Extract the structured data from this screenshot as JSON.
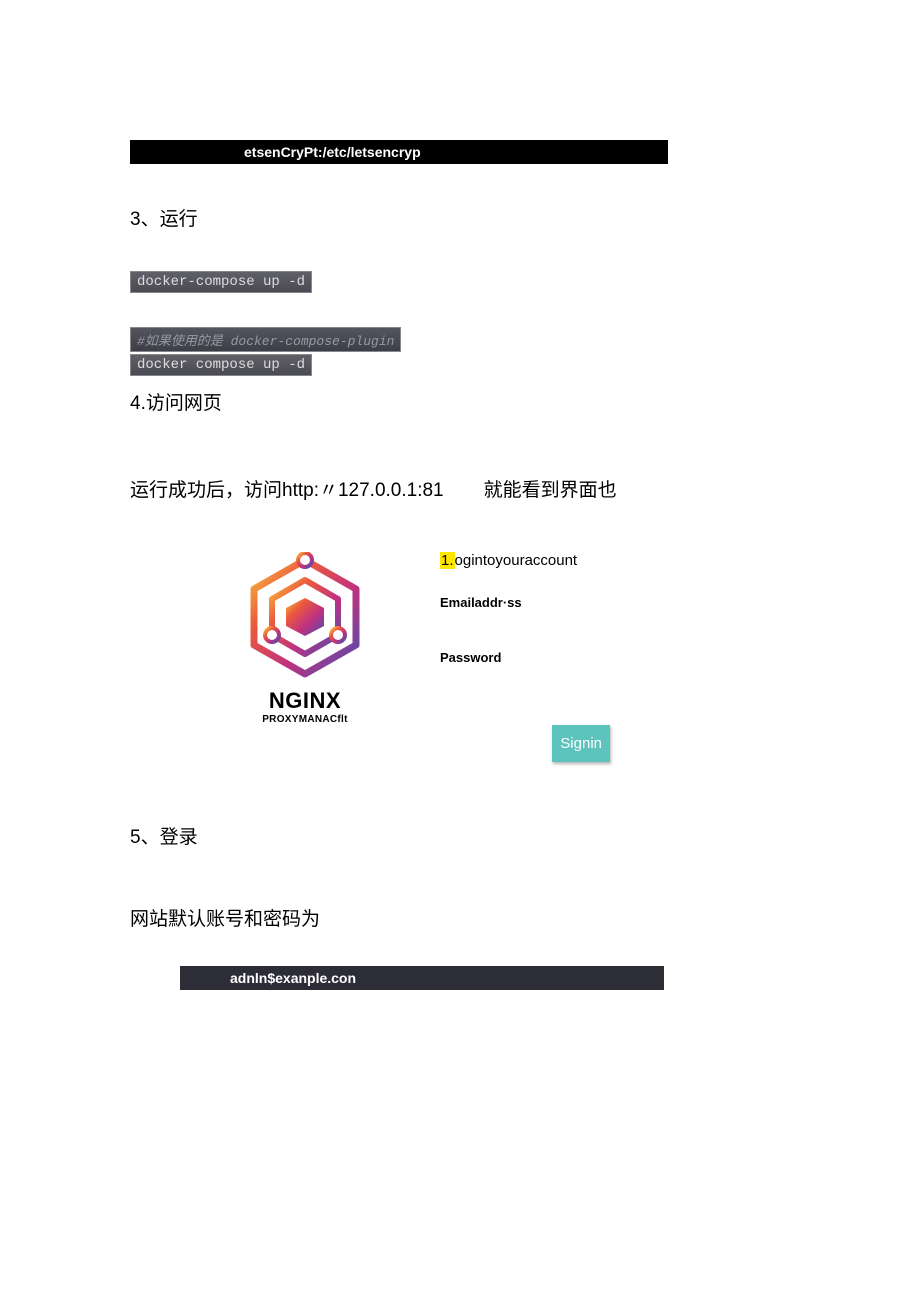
{
  "top_black_bar": "etsenCryPt:/etc/letsencryp",
  "step3_title": "3、运行",
  "code1": "docker-compose up -d",
  "code_comment": "#如果使用的是 docker-compose-plugin",
  "code2": "docker compose up -d",
  "step4_title": "4.访问网页",
  "run_success_left": "运行成功后，访问http:〃127.0.0.1:81",
  "run_success_right": "就能看到界面也",
  "logo_title": "NGINX",
  "logo_sub": "PROXYMANACflt",
  "login_title_prefix": "1.",
  "login_title_rest": "ogintoyouraccount",
  "email_label": "Emailaddr·ss",
  "password_label": "Password",
  "signin_label": "Signin",
  "step5_title": "5、登录",
  "default_creds_text": "网站默认账号和密码为",
  "dark_bar": "adnln$exanple.con"
}
